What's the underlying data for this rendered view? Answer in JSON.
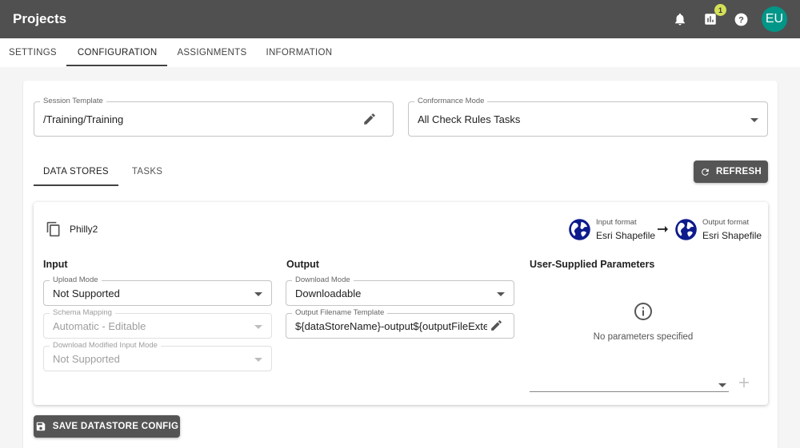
{
  "app": {
    "title": "Projects",
    "notifications_badge": "1",
    "avatar_initials": "EU"
  },
  "page_tabs": [
    {
      "label": "SETTINGS",
      "active": false
    },
    {
      "label": "CONFIGURATION",
      "active": true
    },
    {
      "label": "ASSIGNMENTS",
      "active": false
    },
    {
      "label": "INFORMATION",
      "active": false
    }
  ],
  "session_template": {
    "label": "Session Template",
    "value": "/Training/Training"
  },
  "conformance_mode": {
    "label": "Conformance Mode",
    "value": "All Check Rules Tasks"
  },
  "sub_tabs": [
    {
      "label": "DATA STORES",
      "active": true
    },
    {
      "label": "TASKS",
      "active": false
    }
  ],
  "refresh_label": "REFRESH",
  "datastore": {
    "name": "Philly2",
    "input_format_label": "Input format",
    "input_format_value": "Esri Shapefile",
    "output_format_label": "Output format",
    "output_format_value": "Esri Shapefile",
    "input_title": "Input",
    "output_title": "Output",
    "params_title": "User-Supplied Parameters",
    "upload_mode": {
      "label": "Upload Mode",
      "value": "Not Supported"
    },
    "schema_mapping": {
      "label": "Schema Mapping",
      "value": "Automatic - Editable"
    },
    "download_modified": {
      "label": "Download Modified Input Mode",
      "value": "Not Supported"
    },
    "download_mode": {
      "label": "Download Mode",
      "value": "Downloadable"
    },
    "output_filename": {
      "label": "Output Filename Template",
      "value": "${dataStoreName}-output${outputFileExte"
    },
    "no_params_text": "No parameters specified"
  },
  "save_label": "SAVE DATASTORE CONFIG",
  "colors": {
    "appbar": "#505050",
    "avatar": "#009688",
    "badge": "#d4e157",
    "globe": "#0d1b8c"
  }
}
